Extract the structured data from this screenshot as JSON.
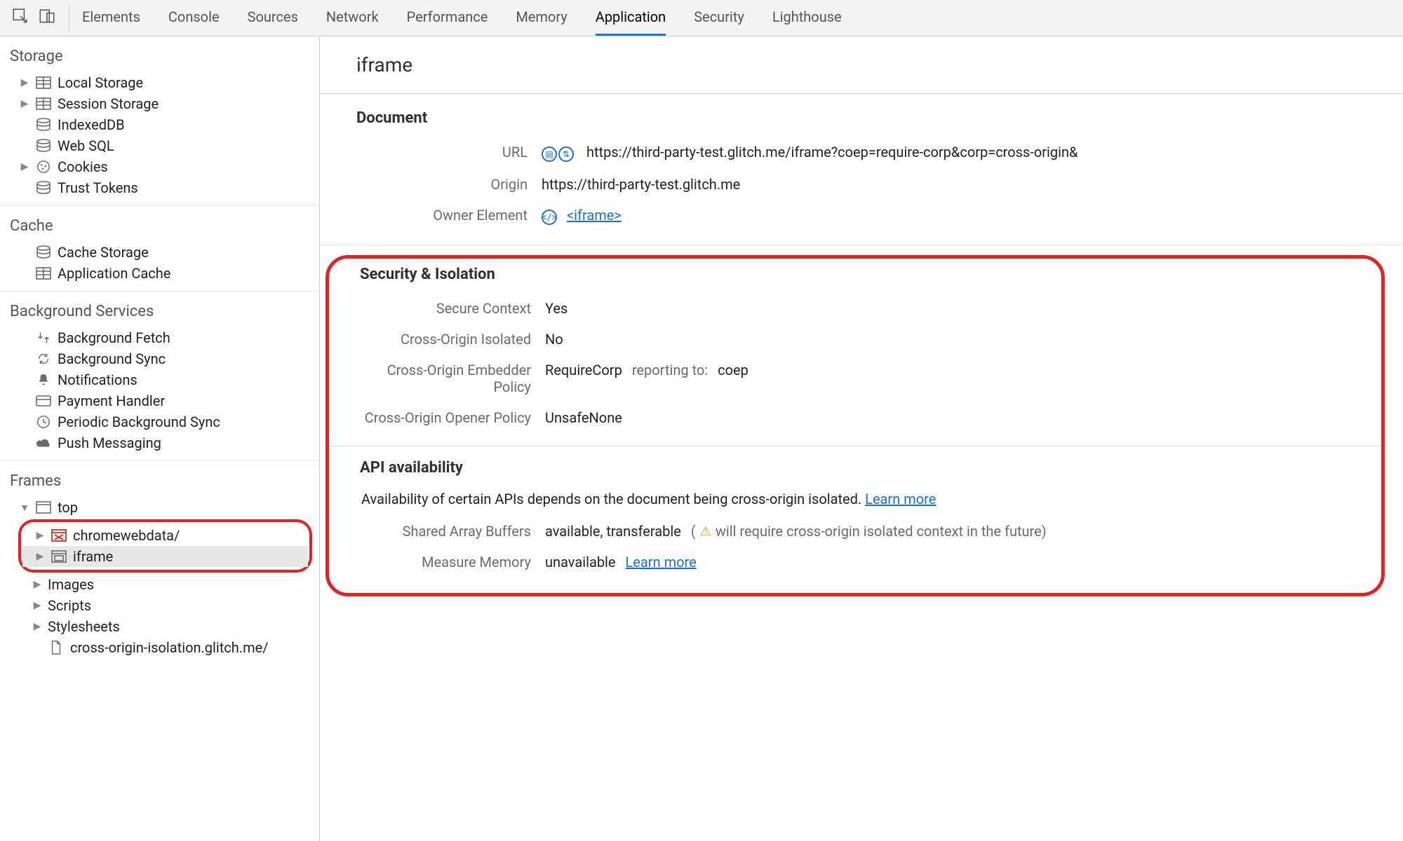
{
  "toolbar": {
    "tabs": [
      "Elements",
      "Console",
      "Sources",
      "Network",
      "Performance",
      "Memory",
      "Application",
      "Security",
      "Lighthouse"
    ],
    "active": "Application"
  },
  "sidebar": {
    "storage": {
      "title": "Storage",
      "items": [
        "Local Storage",
        "Session Storage",
        "IndexedDB",
        "Web SQL",
        "Cookies",
        "Trust Tokens"
      ]
    },
    "cache": {
      "title": "Cache",
      "items": [
        "Cache Storage",
        "Application Cache"
      ]
    },
    "bg": {
      "title": "Background Services",
      "items": [
        "Background Fetch",
        "Background Sync",
        "Notifications",
        "Payment Handler",
        "Periodic Background Sync",
        "Push Messaging"
      ]
    },
    "frames": {
      "title": "Frames",
      "top": "top",
      "chrome": "chromewebdata/",
      "iframe": "iframe",
      "images": "Images",
      "scripts": "Scripts",
      "stylesheets": "Stylesheets",
      "last": "cross-origin-isolation.glitch.me/"
    }
  },
  "main": {
    "title": "iframe",
    "document": {
      "heading": "Document",
      "url_label": "URL",
      "url": "https://third-party-test.glitch.me/iframe?coep=require-corp&corp=cross-origin&",
      "origin_label": "Origin",
      "origin": "https://third-party-test.glitch.me",
      "owner_label": "Owner Element",
      "owner_link": "<iframe>"
    },
    "security": {
      "heading": "Security & Isolation",
      "secure_label": "Secure Context",
      "secure_value": "Yes",
      "coi_label": "Cross-Origin Isolated",
      "coi_value": "No",
      "coep_label": "Cross-Origin Embedder Policy",
      "coep_value": "RequireCorp",
      "coep_reporting_label": "reporting to:",
      "coep_reporting": "coep",
      "coop_label": "Cross-Origin Opener Policy",
      "coop_value": "UnsafeNone"
    },
    "api": {
      "heading": "API availability",
      "desc": "Availability of certain APIs depends on the document being cross-origin isolated.",
      "learn_more": "Learn more",
      "sab_label": "Shared Array Buffers",
      "sab_value": "available, transferable",
      "sab_warn": "will require cross-origin isolated context in the future)",
      "sab_warn_prefix": "(⚠",
      "mm_label": "Measure Memory",
      "mm_value": "unavailable"
    }
  }
}
